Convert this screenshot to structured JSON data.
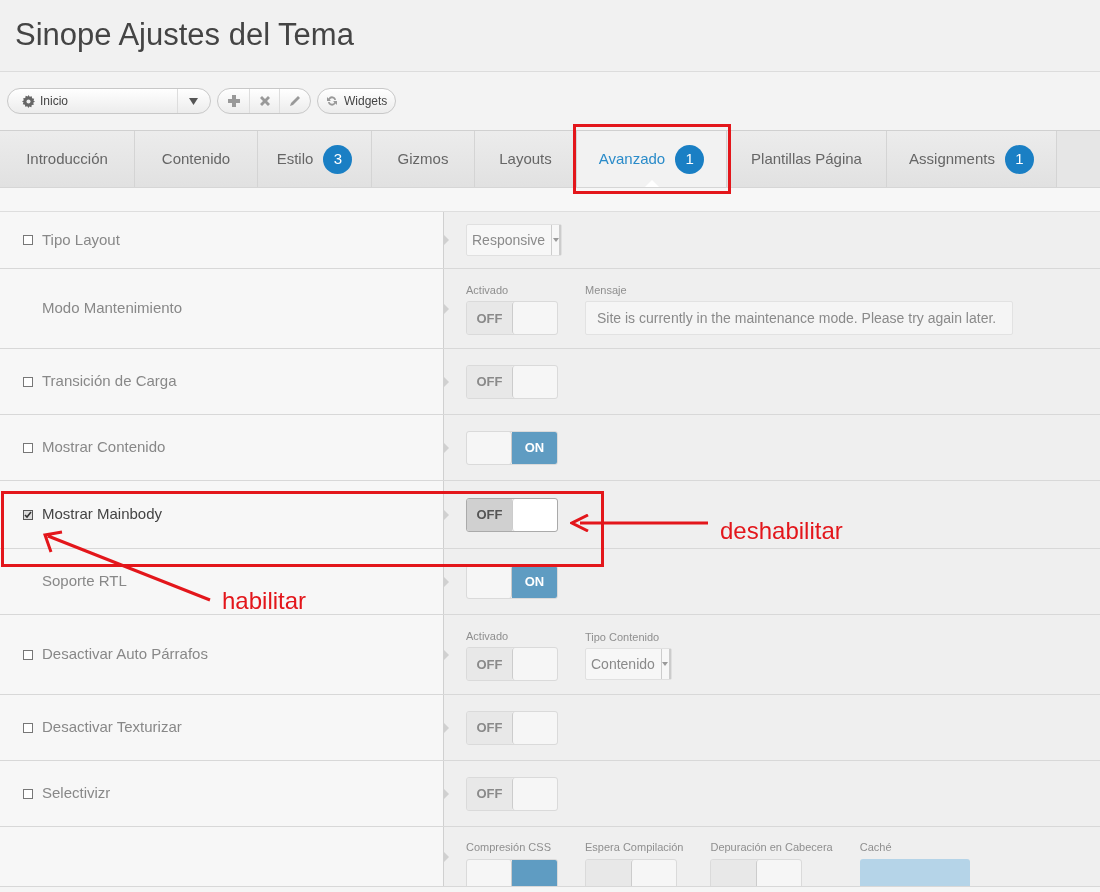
{
  "page_title": "Sinope Ajustes del Tema",
  "toolbar": {
    "style_select": "Inicio",
    "widgets_button": "Widgets"
  },
  "tabs": [
    {
      "label": "Introducción",
      "selected": false
    },
    {
      "label": "Contenido",
      "selected": false
    },
    {
      "label": "Estilo",
      "badge": "3",
      "selected": false
    },
    {
      "label": "Gizmos",
      "selected": false
    },
    {
      "label": "Layouts",
      "selected": false
    },
    {
      "label": "Avanzado",
      "badge": "1",
      "selected": true
    },
    {
      "label": "Plantillas Página",
      "selected": false
    },
    {
      "label": "Assignments",
      "badge": "1",
      "selected": false
    }
  ],
  "rows": [
    {
      "label": "Tipo Layout",
      "has_checkbox": true,
      "checked": false,
      "controls": [
        {
          "kind": "select",
          "value": "Responsive"
        }
      ]
    },
    {
      "label": "Modo Mantenimiento",
      "has_checkbox": false,
      "checked": false,
      "controls": [
        {
          "kind": "toggle",
          "caption": "Activado",
          "on": false,
          "text": "OFF",
          "disabled": true
        },
        {
          "kind": "input",
          "caption": "Mensaje",
          "value": "Site is currently in the maintenance mode. Please try again later."
        }
      ]
    },
    {
      "label": "Transición de Carga",
      "has_checkbox": true,
      "checked": false,
      "controls": [
        {
          "kind": "toggle",
          "on": false,
          "text": "OFF",
          "disabled": true
        }
      ]
    },
    {
      "label": "Mostrar Contenido",
      "has_checkbox": true,
      "checked": false,
      "controls": [
        {
          "kind": "toggle",
          "on": true,
          "text": "ON",
          "disabled": true
        }
      ]
    },
    {
      "label": "Mostrar Mainbody",
      "has_checkbox": true,
      "checked": true,
      "controls": [
        {
          "kind": "toggle",
          "on": false,
          "text": "OFF",
          "disabled": false
        }
      ]
    },
    {
      "label": "Soporte RTL",
      "has_checkbox": false,
      "checked": false,
      "controls": [
        {
          "kind": "toggle",
          "on": true,
          "text": "ON",
          "disabled": true
        }
      ]
    },
    {
      "label": "Desactivar Auto Párrafos",
      "has_checkbox": true,
      "checked": false,
      "controls": [
        {
          "kind": "toggle",
          "caption": "Activado",
          "on": false,
          "text": "OFF",
          "disabled": true
        },
        {
          "kind": "select",
          "caption": "Tipo Contenido",
          "value": "Contenido"
        }
      ]
    },
    {
      "label": "Desactivar Texturizar",
      "has_checkbox": true,
      "checked": false,
      "controls": [
        {
          "kind": "toggle",
          "on": false,
          "text": "OFF",
          "disabled": true
        }
      ]
    },
    {
      "label": "Selectivizr",
      "has_checkbox": true,
      "checked": false,
      "controls": [
        {
          "kind": "toggle",
          "on": false,
          "text": "OFF",
          "disabled": true
        }
      ]
    },
    {
      "controls": [
        {
          "kind": "toggle",
          "caption": "Compresión CSS",
          "on": true,
          "disabled": true
        },
        {
          "kind": "toggle",
          "caption": "Espera Compilación",
          "on": false,
          "disabled": true
        },
        {
          "kind": "toggle",
          "caption": "Depuración en Cabecera",
          "on": false,
          "disabled": true
        },
        {
          "kind": "bar",
          "caption": "Caché"
        }
      ]
    }
  ],
  "annotations": [
    {
      "kind": "right",
      "text": "deshabilitar"
    },
    {
      "kind": "left",
      "text": "habilitar"
    }
  ]
}
